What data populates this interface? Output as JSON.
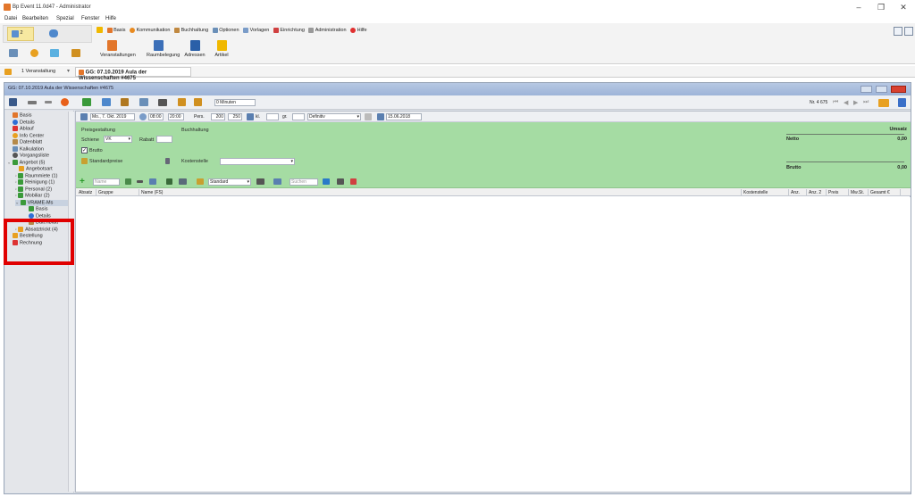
{
  "window": {
    "title": "Bp Event 11.0d47 - Administrator"
  },
  "menu": [
    "Datei",
    "Bearbeiten",
    "Spezial",
    "Fenster",
    "Hilfe"
  ],
  "quick_access": {
    "count": "2"
  },
  "ribbon_tabs": [
    "Basis",
    "Kommunikation",
    "Buchhaltung",
    "Optionen",
    "Vorlagen",
    "Einrichtung",
    "Administration",
    "Hilfe"
  ],
  "ribbon_buttons": [
    "Veranstaltungen",
    "Raumbelegung",
    "Adressen",
    "Artikel"
  ],
  "toolbar2": {
    "view_select": "1 Veranstaltung",
    "active_tab": "GG: 07.10.2019 Aula der Wissenschaften #4675"
  },
  "doc": {
    "title": "GG: 07.10.2019 Aula der Wissenschaften #4675",
    "time_select": "0 Minuten",
    "record_number": "Nr. 4 675"
  },
  "sidebar": {
    "items": [
      {
        "label": "Basis",
        "color": "#e2762b"
      },
      {
        "label": "Details",
        "color": "#2f6fd6"
      },
      {
        "label": "Ablauf",
        "color": "#d33"
      },
      {
        "label": "Info Center",
        "color": "#e8a020"
      },
      {
        "label": "Datenblatt",
        "color": "#b58a4a"
      },
      {
        "label": "Kalkulation",
        "color": "#6a8fb8"
      },
      {
        "label": "Vorgangsliste",
        "color": "#555"
      },
      {
        "label": "Angebot (5)",
        "color": "#3a9a3a"
      },
      {
        "label": "Angebotsart",
        "color": "#e8a020"
      },
      {
        "label": "Raummiete (1)",
        "color": "#3a9a3a"
      },
      {
        "label": "Reinigung (1)",
        "color": "#3a9a3a"
      },
      {
        "label": "Personal (2)",
        "color": "#3a9a3a"
      },
      {
        "label": "Mobiliar (2)",
        "color": "#3a9a3a"
      },
      {
        "label": "VRAME-Ms",
        "color": "#3a9a3a"
      },
      {
        "label": "Basis",
        "color": "#3a9a3a"
      },
      {
        "label": "Details",
        "color": "#2f6fd6"
      },
      {
        "label": "Datenblatt",
        "color": "#b58a4a"
      },
      {
        "label": "Absatztrickt (4)",
        "color": "#e8a020"
      },
      {
        "label": "Bestellung",
        "color": "#e8a020"
      },
      {
        "label": "Rechnung",
        "color": "#d33"
      }
    ]
  },
  "filter": {
    "date_from": "Mo., 7. Okt. 2019",
    "time_from": "08:00",
    "time_to": "20:00",
    "pers_label": "Pers.",
    "pers_value": "200",
    "pers_max": "250",
    "kl_label": "kl.",
    "gr_label": "gr.",
    "status": "Definitiv",
    "date_to": "15.06.2018"
  },
  "green": {
    "section1": "Preisgestaltung",
    "section2": "Buchhaltung",
    "schiene_label": "Schiene",
    "schiene_value": "VK",
    "rabatt_label": "Rabatt",
    "brutto_label": "Brutto",
    "standardpreise_label": "Standardpreise",
    "kostenstelle_label": "Kostenstelle"
  },
  "summary": {
    "umsatz_label": "Umsatz",
    "netto_label": "Netto",
    "netto_value": "0,00",
    "brutto_label": "Brutto",
    "brutto_value": "0,00"
  },
  "gridtool": {
    "search_placeholder": "Name",
    "view_select": "Standard",
    "search2_placeholder": "Suchen"
  },
  "columns": [
    "Absatz",
    "Gruppe",
    "Name (FS)",
    "Kostenstelle",
    "Anz.",
    "Anz. 2",
    "Preis",
    "Mw.St.",
    "Gesamt €"
  ]
}
